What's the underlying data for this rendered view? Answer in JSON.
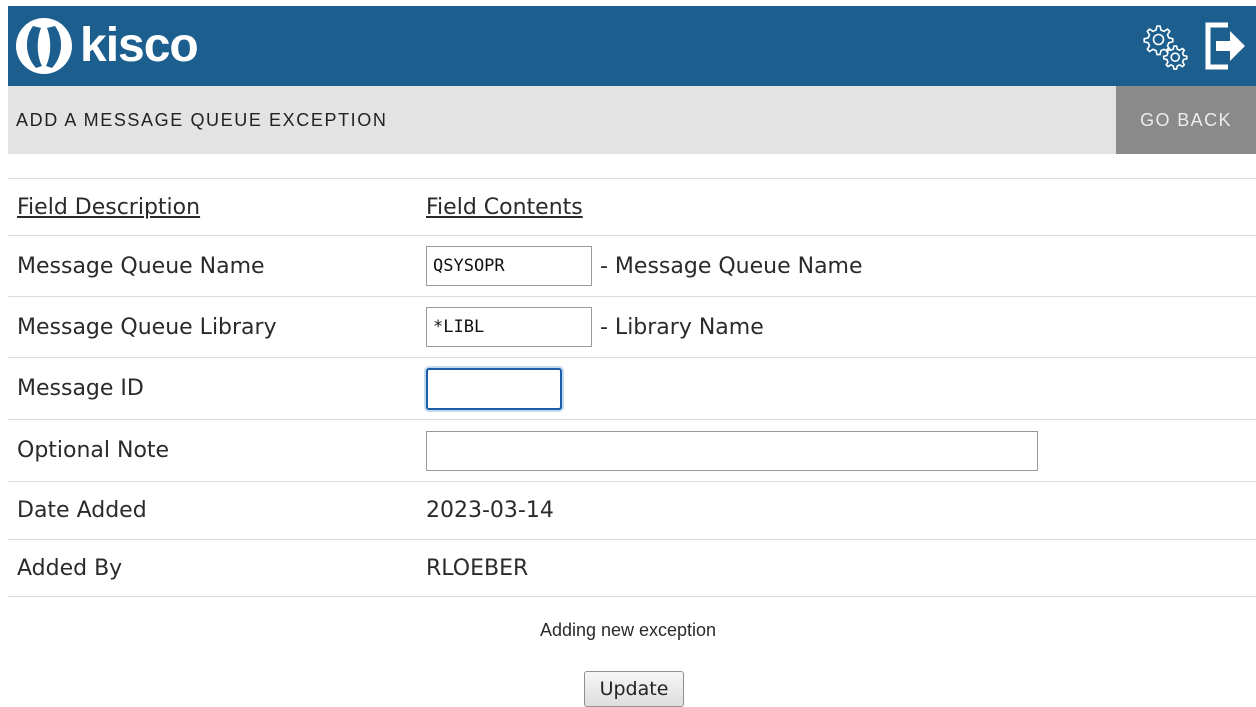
{
  "header": {
    "brand": "kisco",
    "icons": [
      "settings-gear-icon",
      "logout-icon"
    ],
    "colors": {
      "topbar": "#1c5f8e",
      "titlebar": "#e3e3e3",
      "go_back": "#8a8a8a"
    }
  },
  "titlebar": {
    "title": "ADD A MESSAGE QUEUE EXCEPTION",
    "go_back_label": "GO BACK"
  },
  "form": {
    "col_description": "Field Description",
    "col_contents": "Field Contents",
    "queue_name": {
      "label": "Message Queue Name",
      "value": "QSYSOPR",
      "hint": "- Message Queue Name"
    },
    "queue_library": {
      "label": "Message Queue Library",
      "value": "*LIBL",
      "hint": "- Library Name"
    },
    "message_id": {
      "label": "Message ID",
      "value": ""
    },
    "note": {
      "label": "Optional Note",
      "value": ""
    },
    "date_added": {
      "label": "Date Added",
      "value": "2023-03-14"
    },
    "added_by": {
      "label": "Added By",
      "value": "RLOEBER"
    }
  },
  "status_message": "Adding new exception",
  "update_label": "Update"
}
